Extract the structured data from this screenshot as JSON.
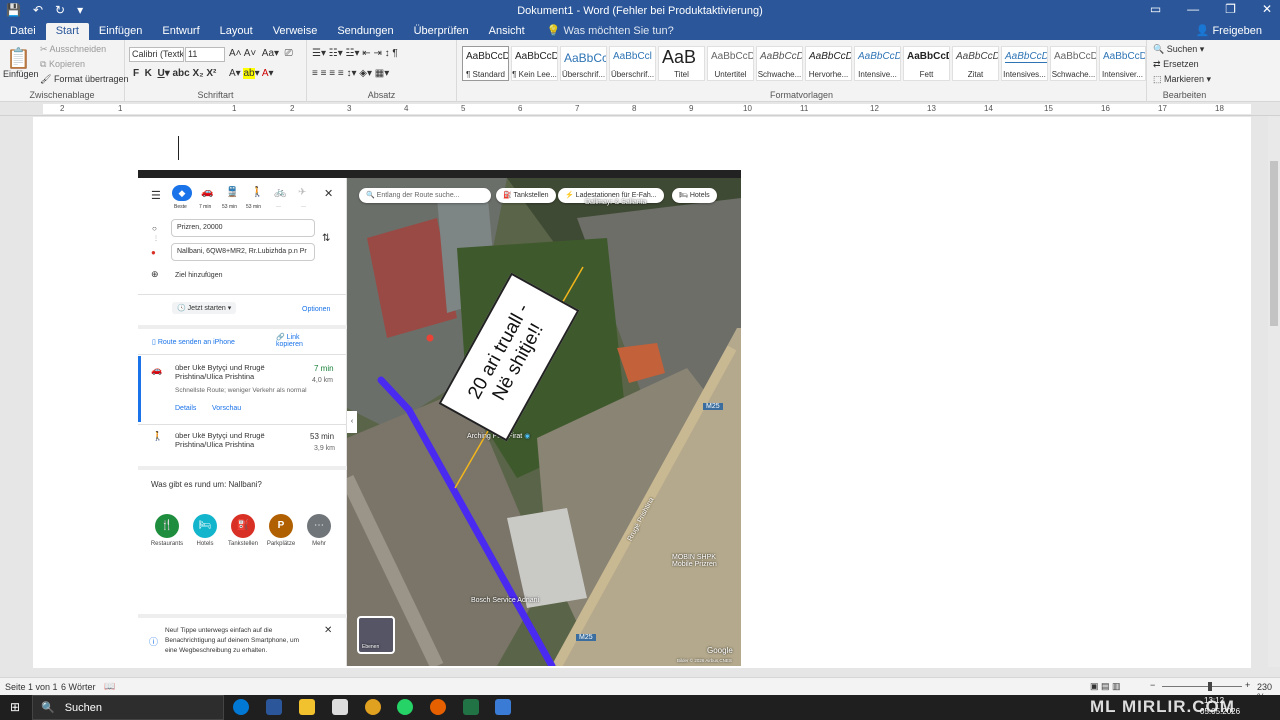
{
  "window": {
    "title": "Dokument1 - Word (Fehler bei Produktaktivierung)"
  },
  "tabs": [
    "Datei",
    "Start",
    "Einfügen",
    "Entwurf",
    "Layout",
    "Verweise",
    "Sendungen",
    "Überprüfen",
    "Ansicht"
  ],
  "tell_me": "Was möchten Sie tun?",
  "share_label": "Freigeben",
  "ribbon": {
    "clipboard": {
      "paste": "Einfügen",
      "cut": "Ausschneiden",
      "copy": "Kopieren",
      "format_painter": "Format übertragen",
      "label": "Zwischenablage"
    },
    "font": {
      "name": "Calibri (Textk",
      "size": "11",
      "label": "Schriftart"
    },
    "paragraph": {
      "label": "Absatz"
    },
    "styles": {
      "label": "Formatvorlagen",
      "items": [
        {
          "sample": "AaBbCcDc",
          "name": "¶ Standard"
        },
        {
          "sample": "AaBbCcDc",
          "name": "¶ Kein Lee..."
        },
        {
          "sample": "AaBbCc",
          "name": "Überschrif..."
        },
        {
          "sample": "AaBbCcl",
          "name": "Überschrif..."
        },
        {
          "sample": "AaB",
          "name": "Titel"
        },
        {
          "sample": "AaBbCcD",
          "name": "Untertitel"
        },
        {
          "sample": "AaBbCcDc",
          "name": "Schwache..."
        },
        {
          "sample": "AaBbCcDc",
          "name": "Hervorhe..."
        },
        {
          "sample": "AaBbCcDc",
          "name": "Intensive..."
        },
        {
          "sample": "AaBbCcDc",
          "name": "Fett"
        },
        {
          "sample": "AaBbCcDc",
          "name": "Zitat"
        },
        {
          "sample": "AaBbCcDc",
          "name": "Intensives..."
        },
        {
          "sample": "AaBbCcDc",
          "name": "Schwache..."
        },
        {
          "sample": "AaBbCcDc",
          "name": "Intensiver..."
        }
      ]
    },
    "editing": {
      "find": "Suchen",
      "replace": "Ersetzen",
      "select": "Markieren",
      "label": "Bearbeiten"
    }
  },
  "ruler_ticks": [
    "2",
    "1",
    "1",
    "2",
    "3",
    "4",
    "5",
    "6",
    "7",
    "8",
    "9",
    "10",
    "11",
    "12",
    "13",
    "14",
    "15",
    "16",
    "17",
    "18"
  ],
  "map_shot": {
    "modes": {
      "best": "Beste",
      "car": "7 min",
      "transit": "53 min",
      "walk": "53 min",
      "bike": "—",
      "flight": "—"
    },
    "origin": "Prizren, 20000",
    "destination": "Nallbani, 6QW8+MR2, Rr.Lubizhda p.n Pr",
    "add_destination": "Ziel hinzufügen",
    "start_now": "Jetzt starten",
    "options": "Optionen",
    "send_to_phone": "Route senden an iPhone",
    "copy_link": "Link kopieren",
    "route1": {
      "via": "über Ukë Bytyçi und Rrugë Prishtina/Ulica Prishtina",
      "time": "7 min",
      "dist": "4,0 km",
      "note": "Schnellste Route; weniger Verkehr als normal",
      "details": "Details",
      "preview": "Vorschau"
    },
    "route2": {
      "via": "über Ukë Bytyçi und Rrugë Prishtina/Ulica Prishtina",
      "time": "53 min",
      "dist": "3,9 km"
    },
    "nearby_title": "Was gibt es rund um: Nallbani?",
    "categories": [
      "Restaurants",
      "Hotels",
      "Tankstellen",
      "Parkplätze",
      "Mehr"
    ],
    "tip": "Neu! Tippe unterwegs einfach auf die Benachrichtigung auf deinem Smartphone, um eine Wegbeschreibung zu erhalten.",
    "chips": [
      "Entlang der Route suche...",
      "Tankstellen",
      "Ladestationen für E-Fah...",
      "Hotels"
    ],
    "sign_line1": "20 ari truall -",
    "sign_line2": "Në shitje!!",
    "labels": {
      "place1": "Arching Plus Firat",
      "place2": "MOBIN SHPK Mobile Prizren",
      "place3": "Bosch Service Adnani",
      "road": "Rrugë Prishtina",
      "m25a": "M25",
      "m25b": "M25",
      "layers": "Ebenen",
      "google": "Google",
      "copyright": "Bilder © 2026 Airbus,CNES",
      "place4": "Dallmayr & Sallanta"
    }
  },
  "status": {
    "page": "Seite 1 von 1",
    "words": "6 Wörter",
    "zoom": "230 %"
  },
  "taskbar": {
    "search": "Suchen",
    "time": "13:12",
    "date": "05.05.2026",
    "watermark": "ML MIRLIR.COM"
  }
}
